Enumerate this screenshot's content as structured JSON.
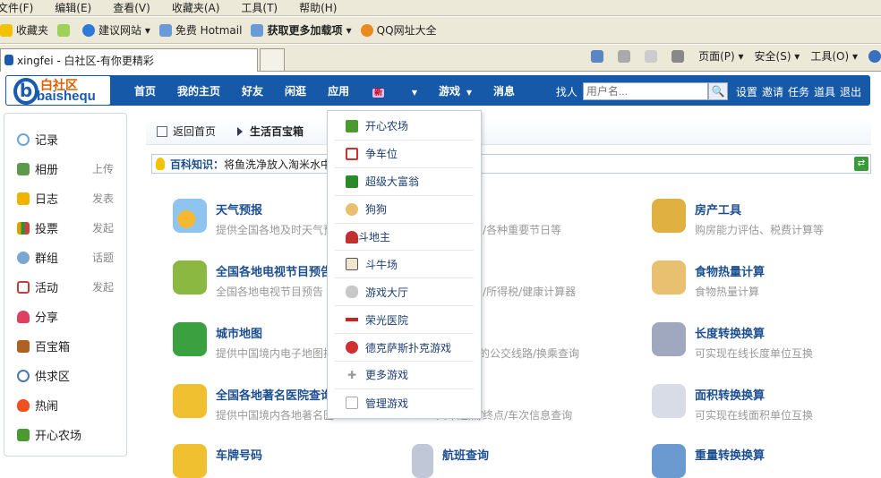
{
  "menubar": [
    "文件(F)",
    "编辑(E)",
    "查看(V)",
    "收藏夹(A)",
    "工具(T)",
    "帮助(H)"
  ],
  "favbar": {
    "favorites": "收藏夹",
    "items": [
      "建议网站 ▾",
      "免费 Hotmail",
      "获取更多加载项 ▾",
      "QQ网址大全"
    ]
  },
  "tab": {
    "title": "xingfei - 白社区-有你更精彩"
  },
  "commandbar": {
    "page": "页面(P) ▾",
    "safety": "安全(S) ▾",
    "tools": "工具(O) ▾"
  },
  "site": {
    "logo_cn": "白社区",
    "logo_en": "baishequ",
    "nav": [
      {
        "label": "首页"
      },
      {
        "label": "我的主页"
      },
      {
        "label": "好友"
      },
      {
        "label": "闲逛"
      },
      {
        "label": "应用",
        "badge": "新"
      },
      {
        "label": "游戏"
      },
      {
        "label": "消息"
      }
    ],
    "search": {
      "label": "找人",
      "placeholder": "用户名...",
      "button": "🔍"
    },
    "quicklinks": [
      "设置",
      "邀请",
      "任务",
      "道具",
      "退出"
    ]
  },
  "sidebar": [
    {
      "label": "记录",
      "action": ""
    },
    {
      "label": "相册",
      "action": "上传"
    },
    {
      "label": "日志",
      "action": "发表"
    },
    {
      "label": "投票",
      "action": "发起"
    },
    {
      "label": "群组",
      "action": "话题"
    },
    {
      "label": "活动",
      "action": "发起"
    },
    {
      "label": "分享",
      "action": ""
    },
    {
      "label": "百宝箱",
      "action": ""
    },
    {
      "label": "供求区",
      "action": ""
    },
    {
      "label": "热闹",
      "action": ""
    },
    {
      "label": "开心农场",
      "action": ""
    }
  ],
  "breadcrumb": {
    "back": "返回首页",
    "current": "生活百宝箱"
  },
  "tip": {
    "label": "百科知识：",
    "text": "将鱼洗净放入淘米水中"
  },
  "tools": [
    {
      "title": "天气预报",
      "desc": "提供全国各地及时天气预"
    },
    {
      "title": "历",
      "desc": "农历/公历/各种重要节日等"
    },
    {
      "title": "房产工具",
      "desc": "购房能力评估、税费计算等"
    },
    {
      "title": "全国各地电视节目预告",
      "desc": "全国各地电视节目预告"
    },
    {
      "title": "计算器",
      "desc": "按揭/存贷/所得税/健康计算器"
    },
    {
      "title": "食物热量计算",
      "desc": "食物热量计算"
    },
    {
      "title": "城市地图",
      "desc": "提供中国境内电子地图搜"
    },
    {
      "title": "查询",
      "desc": "各大城市的公交线路/换乘查询"
    },
    {
      "title": "长度转换换算",
      "desc": "可实现在线长度单位互换"
    },
    {
      "title": "全国各地著名医院查询",
      "desc": "提供中国境内各地著名医"
    },
    {
      "title": "查询",
      "desc": "火车起点/终点/车次信息查询"
    },
    {
      "title": "面积转换换算",
      "desc": "可实现在线面积单位互换"
    },
    {
      "title": "车牌号码",
      "desc": ""
    },
    {
      "title": "航班查询",
      "desc": ""
    },
    {
      "title": "重量转换换算",
      "desc": ""
    }
  ],
  "dropdown": [
    "开心农场",
    "争车位",
    "超级大富翁",
    "狗狗",
    "斗地主",
    "斗牛场",
    "游戏大厅",
    "荣光医院",
    "德克萨斯扑克游戏",
    "更多游戏",
    "管理游戏"
  ]
}
